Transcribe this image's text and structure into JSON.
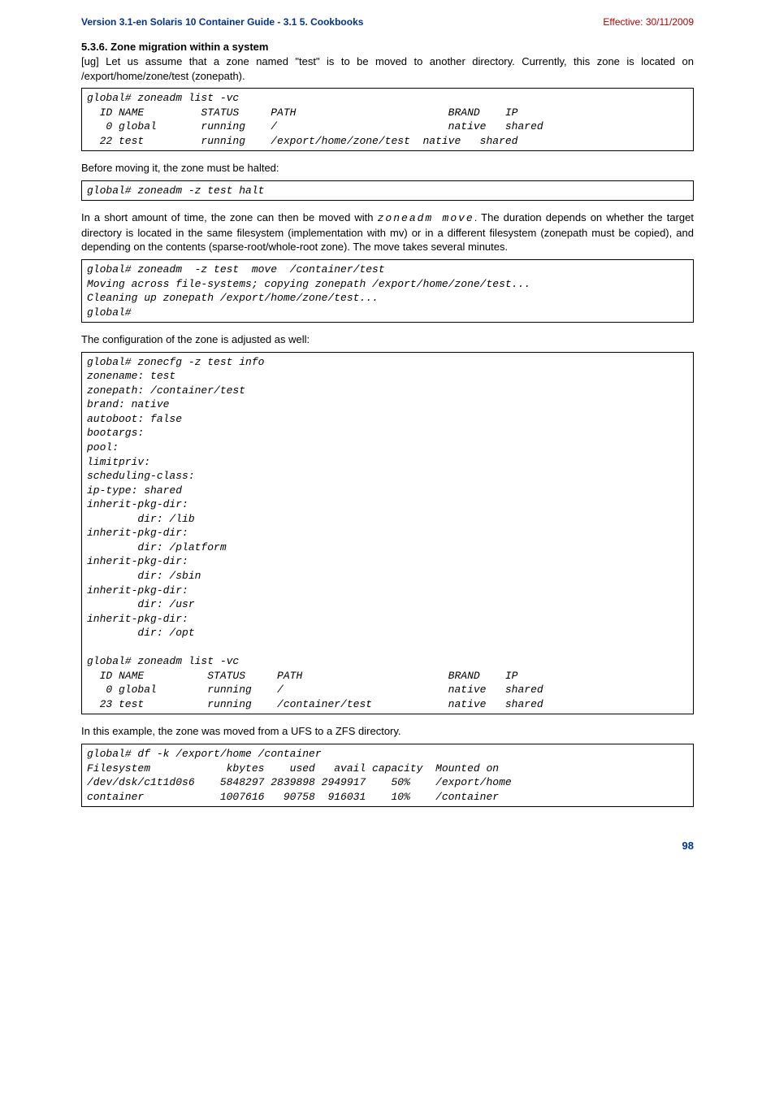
{
  "header": {
    "version": "Version 3.1-en",
    "title_sub": " Solaris 10 Container Guide - 3.1  5. Cookbooks",
    "effective": "Effective: 30/11/2009"
  },
  "section_title": "5.3.6. Zone migration within a system",
  "para1": "[ug] Let us assume that a zone named \"test\" is to be moved to another directory. Currently, this zone is located on /export/home/zone/test (zonepath).",
  "code1": "global# zoneadm list -vc\n  ID NAME         STATUS     PATH                        BRAND    IP\n   0 global       running    /                           native   shared\n  22 test         running    /export/home/zone/test  native   shared",
  "para2": "Before moving it, the zone must be halted:",
  "code2": "global# zoneadm -z test halt",
  "para3_pre": "In a short amount of time, the zone can then be moved with ",
  "para3_mono": "zoneadm move",
  "para3_post": ". The duration depends on whether the target directory is located in the same filesystem (implementation with mv) or in a different filesystem (zonepath must be copied), and depending on the contents (sparse-root/whole-root zone). The move takes several minutes.",
  "code3": "global# zoneadm  -z test  move  /container/test\nMoving across file-systems; copying zonepath /export/home/zone/test...\nCleaning up zonepath /export/home/zone/test...\nglobal#",
  "para4": "The configuration of the zone is adjusted as well:",
  "code4": "global# zonecfg -z test info\nzonename: test\nzonepath: /container/test\nbrand: native\nautoboot: false\nbootargs:\npool:\nlimitpriv:\nscheduling-class:\nip-type: shared\ninherit-pkg-dir:\n        dir: /lib\ninherit-pkg-dir:\n        dir: /platform\ninherit-pkg-dir:\n        dir: /sbin\ninherit-pkg-dir:\n        dir: /usr\ninherit-pkg-dir:\n        dir: /opt\n\nglobal# zoneadm list -vc\n  ID NAME          STATUS     PATH                       BRAND    IP\n   0 global        running    /                          native   shared\n  23 test          running    /container/test            native   shared",
  "para5": "In this example, the zone was moved from a UFS to a ZFS directory.",
  "code5": "global# df -k /export/home /container\nFilesystem            kbytes    used   avail capacity  Mounted on\n/dev/dsk/c1t1d0s6    5848297 2839898 2949917    50%    /export/home\ncontainer            1007616   90758  916031    10%    /container",
  "page_number": "98"
}
